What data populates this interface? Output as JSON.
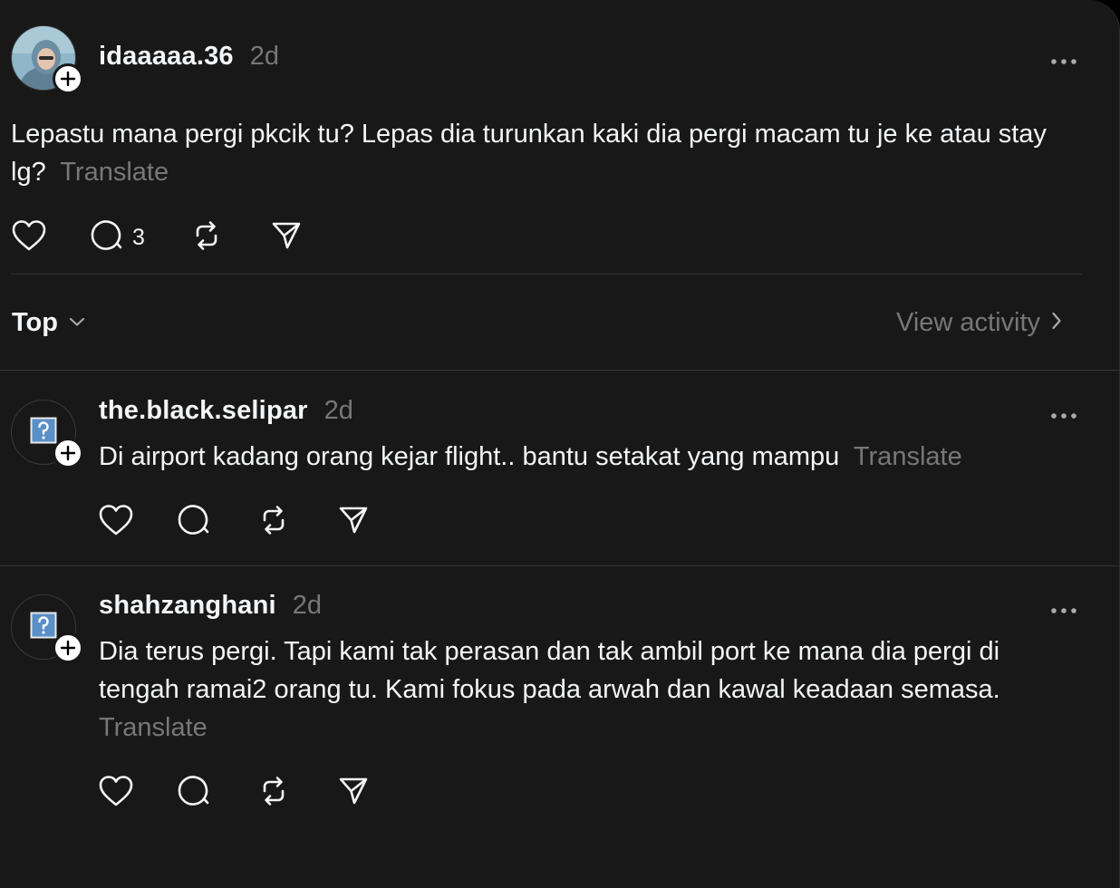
{
  "main_post": {
    "username": "idaaaaa.36",
    "time": "2d",
    "text": "Lepastu mana pergi pkcik tu? Lepas dia turunkan kaki dia pergi macam tu je ke atau stay lg?",
    "translate_label": "Translate",
    "reply_count": "3",
    "icons": [
      "like-icon",
      "reply-icon",
      "repost-icon",
      "share-icon",
      "more-icon"
    ]
  },
  "sort_bar": {
    "sort_label": "Top",
    "view_activity_label": "View activity"
  },
  "replies": [
    {
      "username": "the.black.selipar",
      "time": "2d",
      "text": "Di airport kadang orang kejar flight.. bantu setakat yang mampu",
      "translate_label": "Translate"
    },
    {
      "username": "shahzanghani",
      "time": "2d",
      "text": "Dia terus pergi. Tapi kami tak perasan dan tak ambil port ke mana dia pergi di tengah ramai2 orang tu. Kami fokus pada arwah dan kawal keadaan semasa.",
      "translate_label": "Translate"
    }
  ],
  "colors": {
    "background": "#181818",
    "text": "#f3f5f7",
    "muted": "#777777",
    "divider": "#333333"
  }
}
